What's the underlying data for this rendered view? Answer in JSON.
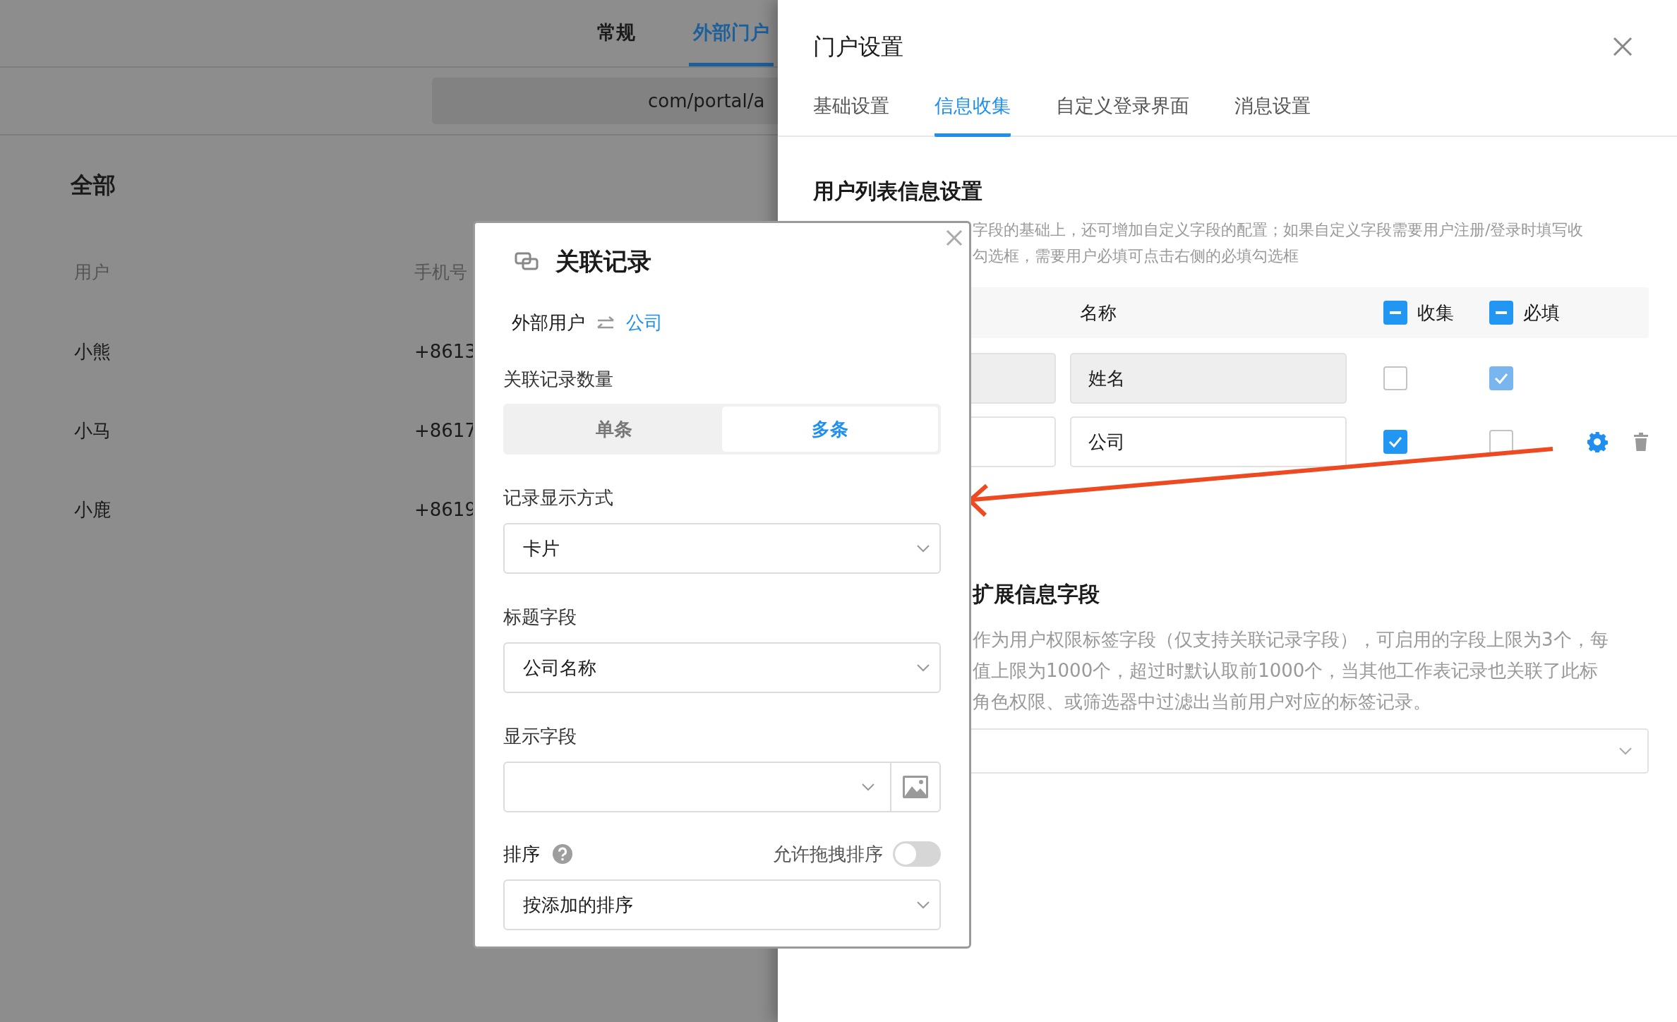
{
  "background_page": {
    "tabs": [
      {
        "label": "常规",
        "selected": false
      },
      {
        "label": "外部门户",
        "selected": true
      }
    ],
    "url": "com/portal/a",
    "section_title": "全部",
    "table": {
      "columns": [
        "用户",
        "手机号"
      ],
      "rows": [
        [
          "小熊",
          "+8613"
        ],
        [
          "小马",
          "+8617"
        ],
        [
          "小鹿",
          "+8619"
        ]
      ]
    }
  },
  "drawer": {
    "title": "门户设置",
    "tabs": [
      {
        "label": "基础设置",
        "selected": false
      },
      {
        "label": "信息收集",
        "selected": true
      },
      {
        "label": "自定义登录界面",
        "selected": false
      },
      {
        "label": "消息设置",
        "selected": false
      }
    ],
    "section_title": "用户列表信息设置",
    "description_lines": [
      "字段的基础上，还可增加自定义字段的配置；如果自定义字段需要用户注册/登录时填写收",
      "勾选框，需要用户必填可点击右侧的必填勾选框"
    ],
    "field_table": {
      "name_column": "名称",
      "collect_column": {
        "label": "收集",
        "indeterminate": true
      },
      "required_column": {
        "label": "必填",
        "indeterminate": true
      },
      "rows": [
        {
          "name": "姓名",
          "name_disabled": true,
          "collect": false,
          "required": true,
          "required_disabled": true,
          "actions": false
        },
        {
          "name": "公司",
          "name_disabled": false,
          "collect": true,
          "required": false,
          "required_disabled": false,
          "actions": true
        }
      ]
    },
    "extension": {
      "title": "扩展信息字段",
      "description_lines": [
        "作为用户权限标签字段（仅支持关联记录字段），可启用的字段上限为3个，每",
        "值上限为1000个，超过时默认取前1000个，当其他工作表记录也关联了此标",
        "角色权限、或筛选器中过滤出当前用户对应的标签记录。"
      ]
    }
  },
  "popup": {
    "title": "关联记录",
    "relation": {
      "source": "外部用户",
      "target": "公司"
    },
    "fields": [
      {
        "kind": "segmented",
        "label": "关联记录数量",
        "options": [
          {
            "label": "单条",
            "selected": false
          },
          {
            "label": "多条",
            "selected": true
          }
        ]
      },
      {
        "kind": "select",
        "label": "记录显示方式",
        "value": "卡片"
      },
      {
        "kind": "select",
        "label": "标题字段",
        "value": "公司名称"
      },
      {
        "kind": "select_image",
        "label": "显示字段"
      },
      {
        "kind": "sort",
        "label": "排序",
        "toggle_label": "允许拖拽排序",
        "on": false,
        "value": "按添加的排序"
      }
    ]
  }
}
